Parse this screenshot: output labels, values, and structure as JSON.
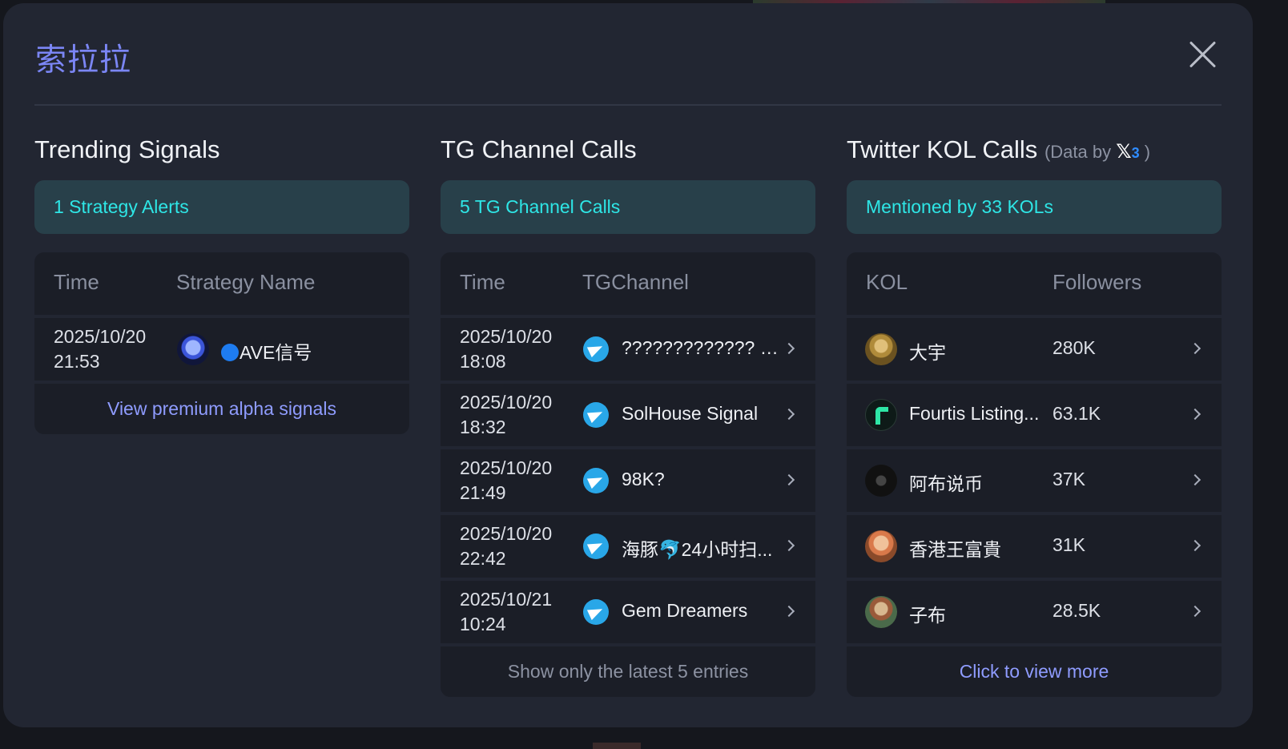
{
  "modal": {
    "title": "索拉拉"
  },
  "trending": {
    "heading": "Trending Signals",
    "banner": "1 Strategy Alerts",
    "col_time": "Time",
    "col_name": "Strategy Name",
    "rows": [
      {
        "date": "2025/10/20",
        "time": "21:53",
        "name": "AVE信号",
        "icon": "ave-logo-icon"
      }
    ],
    "footer_link": "View premium alpha signals"
  },
  "tg": {
    "heading": "TG Channel Calls",
    "banner": "5 TG Channel Calls",
    "col_time": "Time",
    "col_channel": "TGChannel",
    "rows": [
      {
        "date": "2025/10/20",
        "time": "18:08",
        "channel": "????????????? - ...",
        "icon": "telegram-icon"
      },
      {
        "date": "2025/10/20",
        "time": "18:32",
        "channel": "SolHouse Signal",
        "icon": "telegram-icon"
      },
      {
        "date": "2025/10/20",
        "time": "21:49",
        "channel": "98K?",
        "icon": "telegram-icon"
      },
      {
        "date": "2025/10/20",
        "time": "22:42",
        "channel": "海豚🐬24小时扫...",
        "icon": "telegram-icon"
      },
      {
        "date": "2025/10/21",
        "time": "10:24",
        "channel": "Gem Dreamers",
        "icon": "telegram-icon"
      }
    ],
    "footer_note": "Show only the latest 5 entries"
  },
  "kol": {
    "heading": "Twitter KOL Calls",
    "data_by_prefix": "(Data by",
    "data_by_logo": "𝕏",
    "data_by_logo_suffix": "3",
    "data_by_suffix": ")",
    "banner": "Mentioned by 33 KOLs",
    "col_kol": "KOL",
    "col_followers": "Followers",
    "rows": [
      {
        "name": "大宇",
        "followers": "280K",
        "avatar_color": "#b08b3a"
      },
      {
        "name": "Fourtis Listing...",
        "followers": "63.1K",
        "avatar_color": "#0e1a18"
      },
      {
        "name": "阿布说币",
        "followers": "37K",
        "avatar_color": "#1a1a1a"
      },
      {
        "name": "香港王富貴",
        "followers": "31K",
        "avatar_color": "#c98a5a"
      },
      {
        "name": "子布",
        "followers": "28.5K",
        "avatar_color": "#7a5a3a"
      }
    ],
    "footer_link": "Click to view more"
  },
  "colors": {
    "accent": "#7b86f5",
    "banner_text": "#2ee6e6",
    "link": "#8f9cff"
  }
}
